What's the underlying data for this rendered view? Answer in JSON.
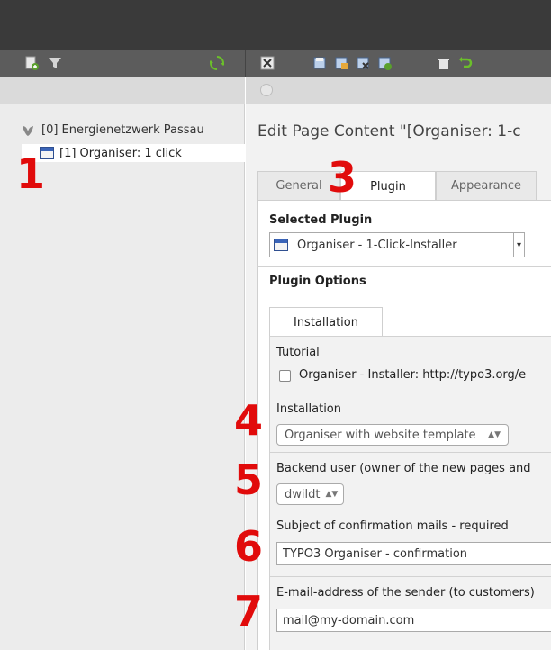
{
  "tree": {
    "root_label": "[0] Energienetzwerk Passau",
    "child_label": "[1] Organiser: 1 click"
  },
  "main": {
    "title": "Edit Page Content \"[Organiser: 1-c",
    "tabs": [
      {
        "label": "General"
      },
      {
        "label": "Plugin"
      },
      {
        "label": "Appearance"
      }
    ],
    "selected_plugin_heading": "Selected Plugin",
    "selected_plugin_value": "Organiser - 1-Click-Installer",
    "plugin_options_heading": "Plugin Options",
    "inner_tab_label": "Installation",
    "fields": {
      "tutorial_label": "Tutorial",
      "tutorial_checkbox_label": "Organiser - Installer: http://typo3.org/e",
      "installation_label": "Installation",
      "installation_value": "Organiser with website template",
      "backend_user_label": "Backend user (owner of the new pages and",
      "backend_user_value": "dwildt",
      "subject_label": "Subject of confirmation mails - required",
      "subject_value": "TYPO3 Organiser - confirmation",
      "sender_label": "E-mail-address of the sender (to customers)",
      "sender_value": "mail@my-domain.com"
    }
  },
  "callouts": [
    "1",
    "3",
    "4",
    "5",
    "6",
    "7"
  ],
  "colors": {
    "topbar": "#3a3a3a",
    "toolbar": "#5c5c5c",
    "callout_red": "#e10b0b",
    "refresh_green": "#6bbf2a"
  }
}
